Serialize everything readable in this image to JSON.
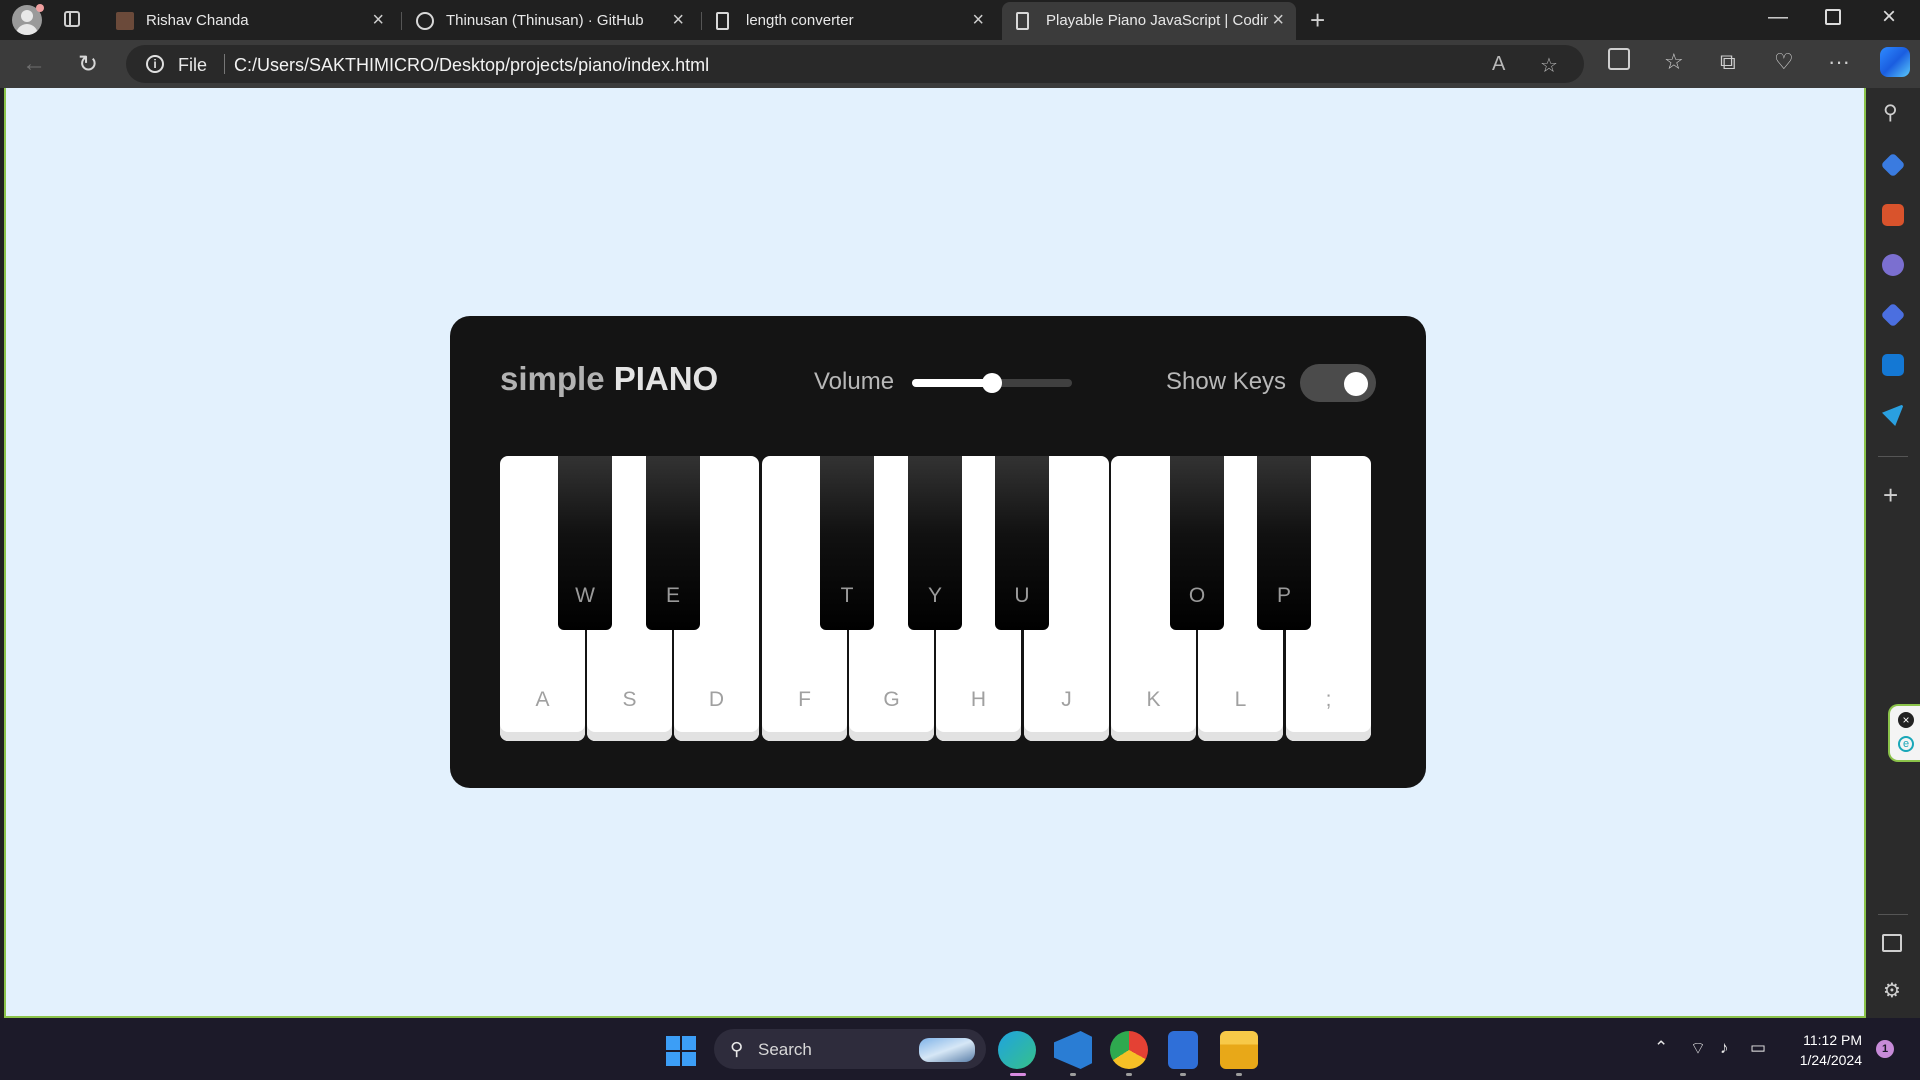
{
  "browser": {
    "tabs": [
      {
        "title": "Rishav Chanda",
        "icon": "user-photo-icon",
        "active": false
      },
      {
        "title": "Thinusan (Thinusan) · GitHub",
        "icon": "github-icon",
        "active": false
      },
      {
        "title": "length converter",
        "icon": "page-icon",
        "active": false
      },
      {
        "title": "Playable Piano JavaScript | Codin",
        "icon": "page-icon",
        "active": true
      }
    ],
    "address": {
      "scheme_label": "File",
      "url": "C:/Users/SAKTHIMICRO/Desktop/projects/piano/index.html"
    }
  },
  "page": {
    "brand_prefix": "simple",
    "brand_main": "PIANO",
    "volume_label": "Volume",
    "volume_value": 0.5,
    "show_keys_label": "Show Keys",
    "show_keys_on": true,
    "white_keys": [
      "A",
      "S",
      "D",
      "F",
      "G",
      "H",
      "J",
      "K",
      "L",
      ";"
    ],
    "black_keys": [
      "W",
      "E",
      "T",
      "Y",
      "U",
      "O",
      "P"
    ]
  },
  "taskbar": {
    "search_label": "Search",
    "time": "11:12 PM",
    "date": "1/24/2024",
    "notification_count": "1"
  },
  "colors": {
    "page_bg": "#e3f1fd",
    "piano_bg": "#141414",
    "accent_border": "#8bc34a"
  }
}
